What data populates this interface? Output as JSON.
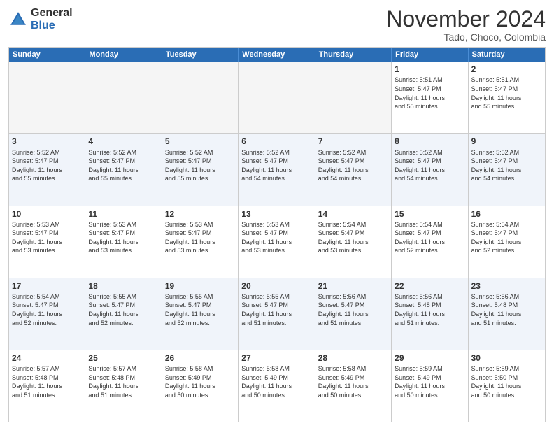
{
  "logo": {
    "general": "General",
    "blue": "Blue"
  },
  "header": {
    "month": "November 2024",
    "location": "Tado, Choco, Colombia"
  },
  "weekdays": [
    "Sunday",
    "Monday",
    "Tuesday",
    "Wednesday",
    "Thursday",
    "Friday",
    "Saturday"
  ],
  "rows": [
    {
      "alt": false,
      "cells": [
        {
          "day": "",
          "info": "",
          "empty": true
        },
        {
          "day": "",
          "info": "",
          "empty": true
        },
        {
          "day": "",
          "info": "",
          "empty": true
        },
        {
          "day": "",
          "info": "",
          "empty": true
        },
        {
          "day": "",
          "info": "",
          "empty": true
        },
        {
          "day": "1",
          "info": "Sunrise: 5:51 AM\nSunset: 5:47 PM\nDaylight: 11 hours\nand 55 minutes.",
          "empty": false
        },
        {
          "day": "2",
          "info": "Sunrise: 5:51 AM\nSunset: 5:47 PM\nDaylight: 11 hours\nand 55 minutes.",
          "empty": false
        }
      ]
    },
    {
      "alt": true,
      "cells": [
        {
          "day": "3",
          "info": "Sunrise: 5:52 AM\nSunset: 5:47 PM\nDaylight: 11 hours\nand 55 minutes.",
          "empty": false
        },
        {
          "day": "4",
          "info": "Sunrise: 5:52 AM\nSunset: 5:47 PM\nDaylight: 11 hours\nand 55 minutes.",
          "empty": false
        },
        {
          "day": "5",
          "info": "Sunrise: 5:52 AM\nSunset: 5:47 PM\nDaylight: 11 hours\nand 55 minutes.",
          "empty": false
        },
        {
          "day": "6",
          "info": "Sunrise: 5:52 AM\nSunset: 5:47 PM\nDaylight: 11 hours\nand 54 minutes.",
          "empty": false
        },
        {
          "day": "7",
          "info": "Sunrise: 5:52 AM\nSunset: 5:47 PM\nDaylight: 11 hours\nand 54 minutes.",
          "empty": false
        },
        {
          "day": "8",
          "info": "Sunrise: 5:52 AM\nSunset: 5:47 PM\nDaylight: 11 hours\nand 54 minutes.",
          "empty": false
        },
        {
          "day": "9",
          "info": "Sunrise: 5:52 AM\nSunset: 5:47 PM\nDaylight: 11 hours\nand 54 minutes.",
          "empty": false
        }
      ]
    },
    {
      "alt": false,
      "cells": [
        {
          "day": "10",
          "info": "Sunrise: 5:53 AM\nSunset: 5:47 PM\nDaylight: 11 hours\nand 53 minutes.",
          "empty": false
        },
        {
          "day": "11",
          "info": "Sunrise: 5:53 AM\nSunset: 5:47 PM\nDaylight: 11 hours\nand 53 minutes.",
          "empty": false
        },
        {
          "day": "12",
          "info": "Sunrise: 5:53 AM\nSunset: 5:47 PM\nDaylight: 11 hours\nand 53 minutes.",
          "empty": false
        },
        {
          "day": "13",
          "info": "Sunrise: 5:53 AM\nSunset: 5:47 PM\nDaylight: 11 hours\nand 53 minutes.",
          "empty": false
        },
        {
          "day": "14",
          "info": "Sunrise: 5:54 AM\nSunset: 5:47 PM\nDaylight: 11 hours\nand 53 minutes.",
          "empty": false
        },
        {
          "day": "15",
          "info": "Sunrise: 5:54 AM\nSunset: 5:47 PM\nDaylight: 11 hours\nand 52 minutes.",
          "empty": false
        },
        {
          "day": "16",
          "info": "Sunrise: 5:54 AM\nSunset: 5:47 PM\nDaylight: 11 hours\nand 52 minutes.",
          "empty": false
        }
      ]
    },
    {
      "alt": true,
      "cells": [
        {
          "day": "17",
          "info": "Sunrise: 5:54 AM\nSunset: 5:47 PM\nDaylight: 11 hours\nand 52 minutes.",
          "empty": false
        },
        {
          "day": "18",
          "info": "Sunrise: 5:55 AM\nSunset: 5:47 PM\nDaylight: 11 hours\nand 52 minutes.",
          "empty": false
        },
        {
          "day": "19",
          "info": "Sunrise: 5:55 AM\nSunset: 5:47 PM\nDaylight: 11 hours\nand 52 minutes.",
          "empty": false
        },
        {
          "day": "20",
          "info": "Sunrise: 5:55 AM\nSunset: 5:47 PM\nDaylight: 11 hours\nand 51 minutes.",
          "empty": false
        },
        {
          "day": "21",
          "info": "Sunrise: 5:56 AM\nSunset: 5:47 PM\nDaylight: 11 hours\nand 51 minutes.",
          "empty": false
        },
        {
          "day": "22",
          "info": "Sunrise: 5:56 AM\nSunset: 5:48 PM\nDaylight: 11 hours\nand 51 minutes.",
          "empty": false
        },
        {
          "day": "23",
          "info": "Sunrise: 5:56 AM\nSunset: 5:48 PM\nDaylight: 11 hours\nand 51 minutes.",
          "empty": false
        }
      ]
    },
    {
      "alt": false,
      "cells": [
        {
          "day": "24",
          "info": "Sunrise: 5:57 AM\nSunset: 5:48 PM\nDaylight: 11 hours\nand 51 minutes.",
          "empty": false
        },
        {
          "day": "25",
          "info": "Sunrise: 5:57 AM\nSunset: 5:48 PM\nDaylight: 11 hours\nand 51 minutes.",
          "empty": false
        },
        {
          "day": "26",
          "info": "Sunrise: 5:58 AM\nSunset: 5:49 PM\nDaylight: 11 hours\nand 50 minutes.",
          "empty": false
        },
        {
          "day": "27",
          "info": "Sunrise: 5:58 AM\nSunset: 5:49 PM\nDaylight: 11 hours\nand 50 minutes.",
          "empty": false
        },
        {
          "day": "28",
          "info": "Sunrise: 5:58 AM\nSunset: 5:49 PM\nDaylight: 11 hours\nand 50 minutes.",
          "empty": false
        },
        {
          "day": "29",
          "info": "Sunrise: 5:59 AM\nSunset: 5:49 PM\nDaylight: 11 hours\nand 50 minutes.",
          "empty": false
        },
        {
          "day": "30",
          "info": "Sunrise: 5:59 AM\nSunset: 5:50 PM\nDaylight: 11 hours\nand 50 minutes.",
          "empty": false
        }
      ]
    }
  ]
}
